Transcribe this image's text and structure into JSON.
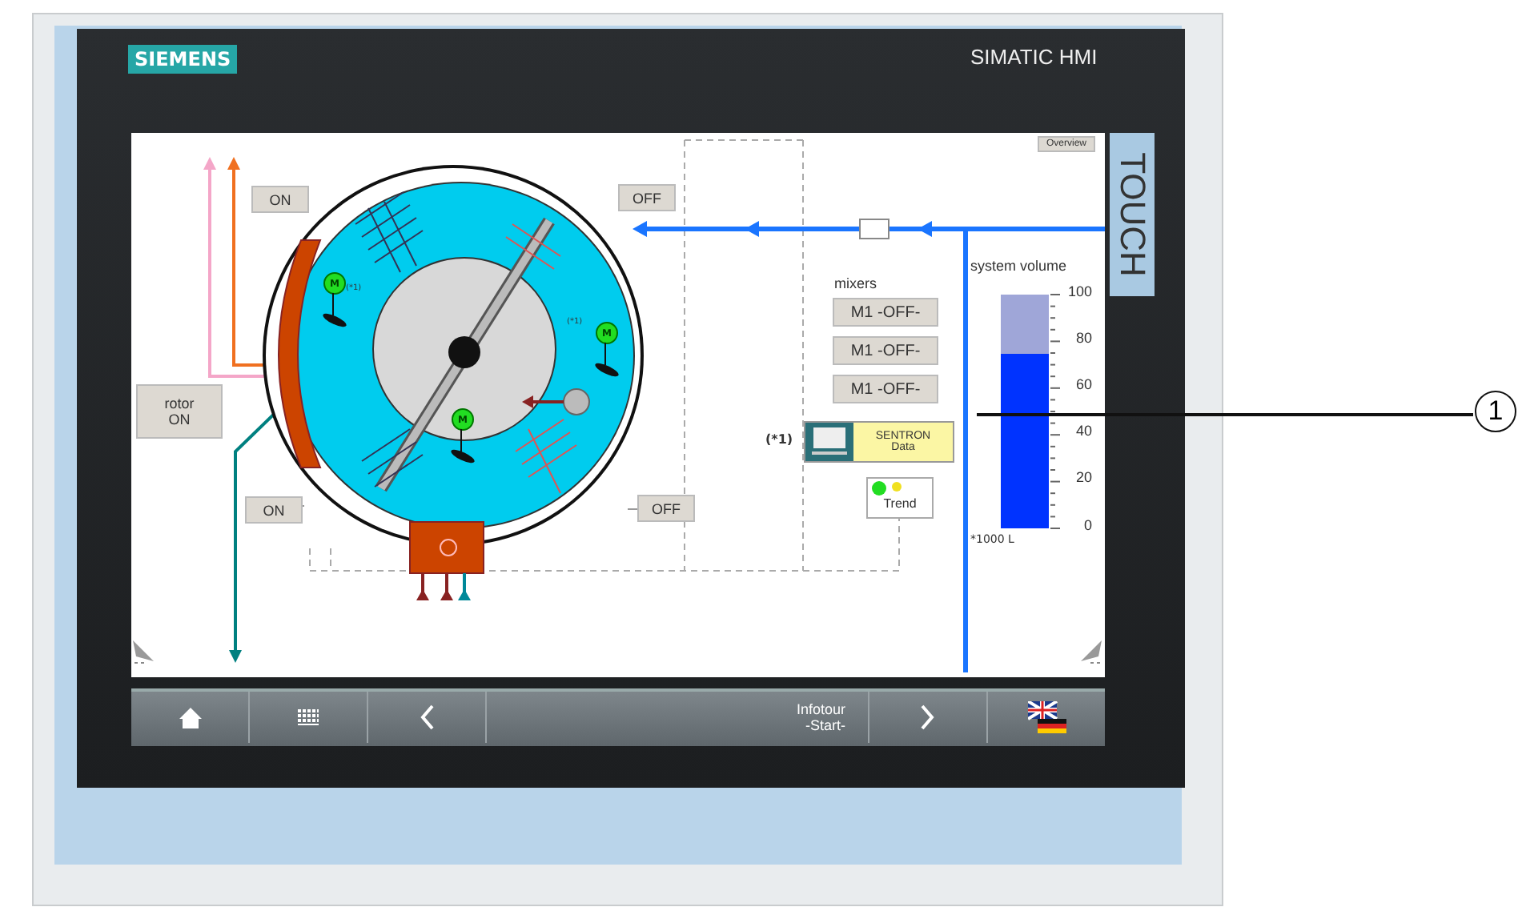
{
  "device": {
    "brand": "SIEMENS",
    "model": "SIMATIC HMI",
    "side_label": "TOUCH"
  },
  "screen": {
    "overview_button": "Overview",
    "switch_buttons": [
      {
        "label": "ON"
      },
      {
        "label": "OFF"
      },
      {
        "label": "ON"
      },
      {
        "label": "OFF"
      }
    ],
    "rotor_button": [
      "rotor",
      "ON"
    ],
    "motors": [
      {
        "label": "M",
        "note": "(*1)"
      },
      {
        "label": "M",
        "note": "(*1)"
      },
      {
        "label": "M"
      }
    ],
    "mixers": {
      "title": "mixers",
      "buttons": [
        "M1 -OFF-",
        "M1 -OFF-",
        "M1 -OFF-"
      ]
    },
    "sentron": {
      "note": "(*1)",
      "lines": [
        "SENTRON",
        "Data"
      ]
    },
    "trend": {
      "label": "Trend"
    },
    "tank": {
      "title": "system volume",
      "level": 0.75,
      "ticks": [
        "100",
        "80",
        "60",
        "40",
        "20",
        "0"
      ],
      "unit": "*1000 L"
    }
  },
  "nav_bar": {
    "items": [
      {
        "kind": "home"
      },
      {
        "kind": "grid"
      },
      {
        "kind": "back"
      },
      {
        "kind": "text",
        "lines": [
          "Infotour",
          "-Start-"
        ]
      },
      {
        "kind": "forward"
      },
      {
        "kind": "language"
      }
    ]
  },
  "callouts": [
    {
      "number": "1"
    }
  ]
}
